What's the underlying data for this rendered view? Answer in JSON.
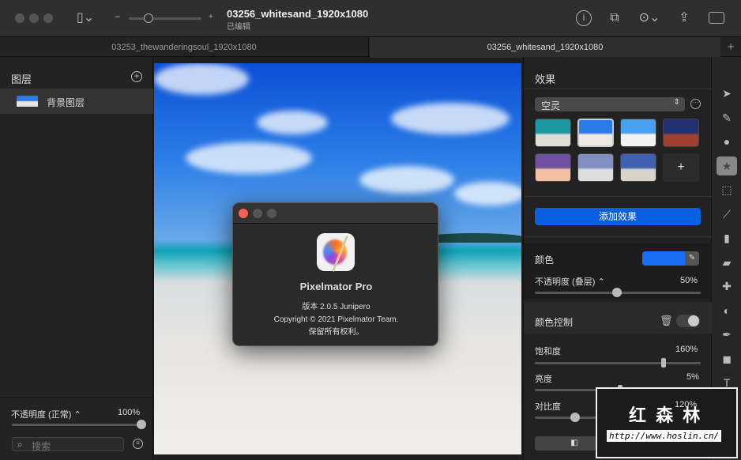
{
  "toolbar": {
    "title": "03256_whitesand_1920x1080",
    "subtitle": "已编辑",
    "zoom_minus": "−",
    "zoom_plus": "+",
    "zoom_level": 0.27
  },
  "tabs": [
    {
      "label": "03253_thewanderingsoul_1920x1080",
      "active": false
    },
    {
      "label": "03256_whitesand_1920x1080",
      "active": true
    }
  ],
  "tabs_add": "+",
  "layers": {
    "title": "图层",
    "items": [
      {
        "name": "背景图层"
      }
    ],
    "opacity_label": "不透明度 (正常) ⌃",
    "opacity_value": "100%",
    "opacity": 1.0,
    "search_placeholder": "搜索"
  },
  "effects": {
    "title": "效果",
    "preset": "空灵",
    "add_button": "添加效果",
    "add_thumb": "+",
    "color_label": "颜色",
    "color": "#1a6ef5",
    "opacity_label": "不透明度 (叠层) ⌃",
    "opacity_value": "50%",
    "opacity": 0.5,
    "color_control_label": "颜色控制",
    "saturation_label": "饱和度",
    "saturation_value": "160%",
    "saturation": 0.79,
    "brightness_label": "亮度",
    "brightness_value": "5%",
    "brightness": 0.52,
    "contrast_label": "对比度",
    "contrast_value": "120%",
    "contrast": 0.22
  },
  "about": {
    "app_name": "Pixelmator Pro",
    "version": "版本 2.0.5 Junipero",
    "copyright": "Copyright © 2021 Pixelmator Team.",
    "rights": "保留所有权利。"
  },
  "watermark": {
    "text": "红 森 林",
    "url": "http://www.hoslin.cn/"
  },
  "colors": {
    "accent": "#0a60e0",
    "close": "#ff5f57"
  }
}
